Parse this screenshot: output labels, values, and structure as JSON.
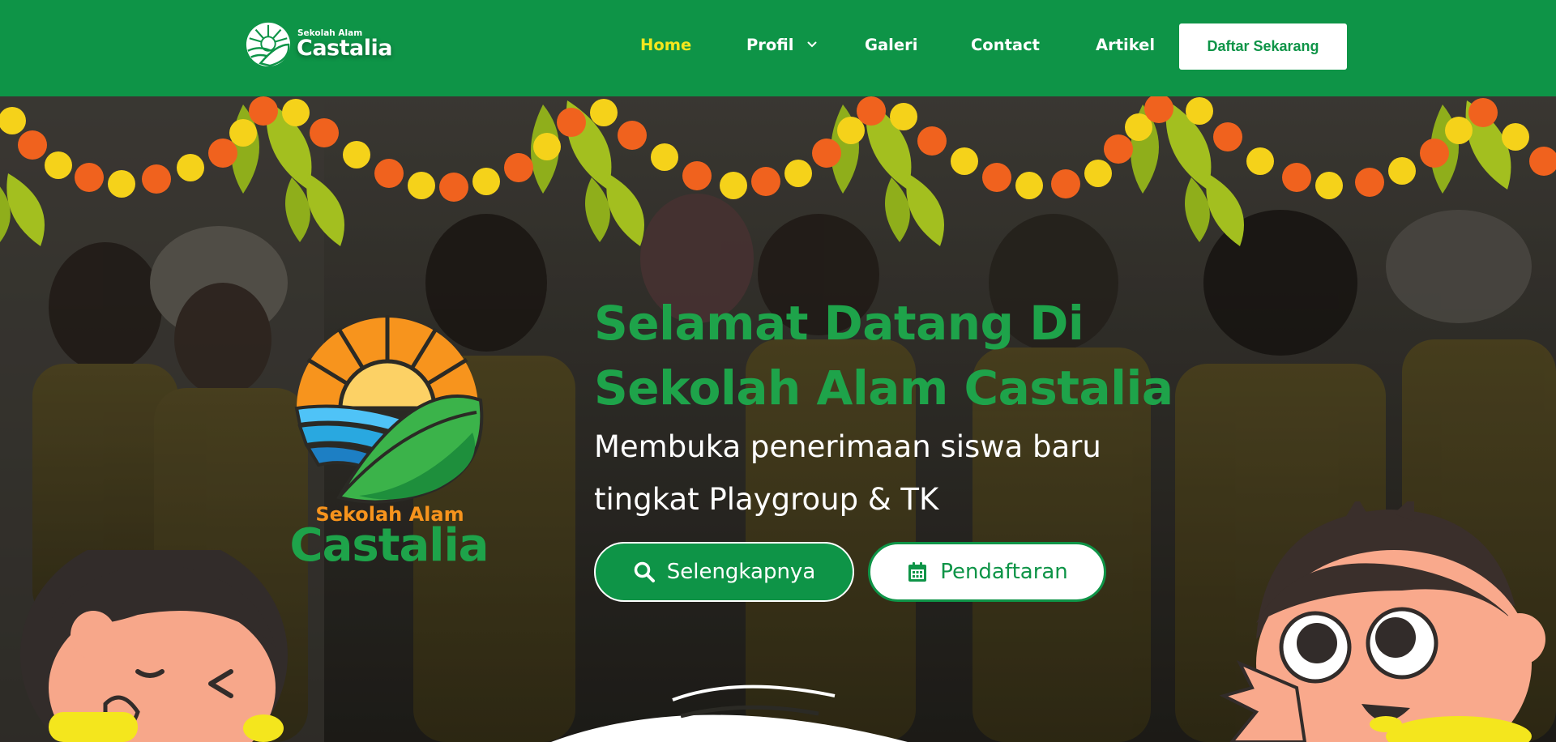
{
  "brand": {
    "small": "Sekolah Alam",
    "big": "Castalia"
  },
  "nav": {
    "items": [
      {
        "label": "Home",
        "active": true
      },
      {
        "label": "Profil",
        "has_dropdown": true
      },
      {
        "label": "Galeri"
      },
      {
        "label": "Contact"
      },
      {
        "label": "Artikel"
      }
    ],
    "cta_label": "Daftar Sekarang"
  },
  "hero": {
    "logo_small": "Sekolah Alam",
    "logo_big": "Castalia",
    "title_line1": "Selamat Datang Di",
    "title_line2": "Sekolah Alam Castalia",
    "subtitle_line1": "Membuka penerimaan siswa baru",
    "subtitle_line2": "tingkat Playgroup & TK",
    "primary_button": {
      "label": "Selengkapnya",
      "icon": "search-icon"
    },
    "secondary_button": {
      "label": "Pendaftaran",
      "icon": "calendar-icon"
    }
  },
  "colors": {
    "header_bg": "#0e9447",
    "nav_active": "#f4e61d",
    "accent_green": "#1ea34a",
    "logo_orange": "#f7941d",
    "white": "#ffffff"
  }
}
